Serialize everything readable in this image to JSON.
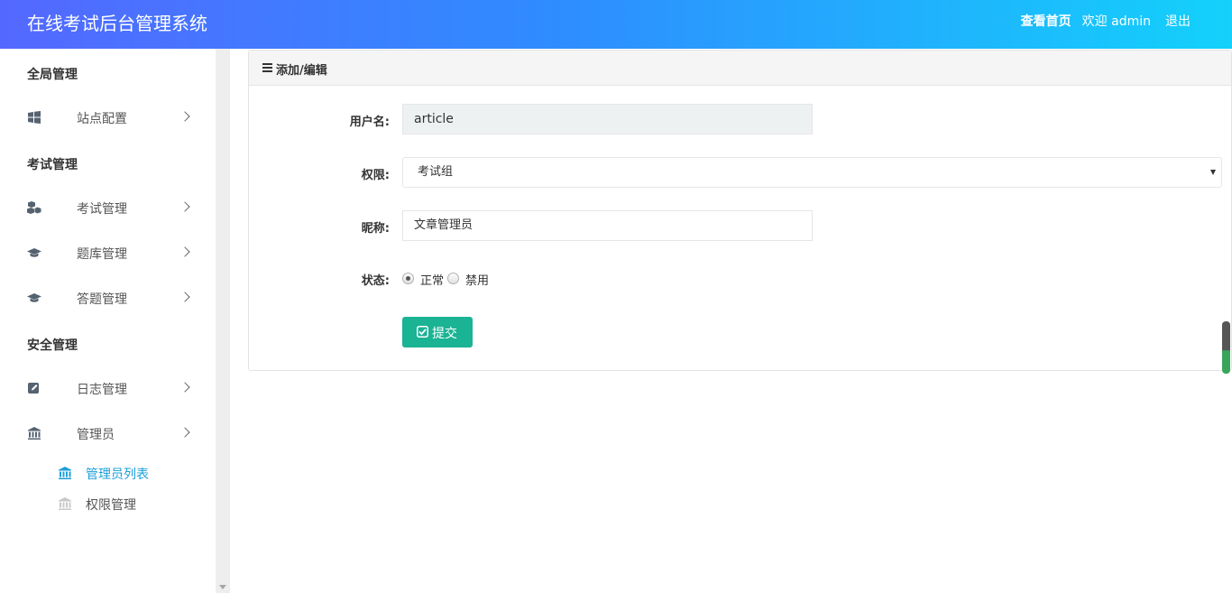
{
  "header": {
    "title": "在线考试后台管理系统",
    "home_link": "查看首页",
    "welcome": "欢迎 admin",
    "logout": "退出"
  },
  "sidebar": {
    "sections": [
      {
        "title": "全局管理"
      },
      {
        "title": "考试管理"
      },
      {
        "title": "安全管理"
      }
    ],
    "items": [
      {
        "label": "站点配置",
        "icon": "windows-icon"
      },
      {
        "label": "考试管理",
        "icon": "cubes-icon"
      },
      {
        "label": "题库管理",
        "icon": "graduation-cap-icon"
      },
      {
        "label": "答题管理",
        "icon": "graduation-cap-icon"
      },
      {
        "label": "日志管理",
        "icon": "edit-icon"
      },
      {
        "label": "管理员",
        "icon": "bank-icon"
      }
    ],
    "subitems": [
      {
        "label": "管理员列表",
        "icon": "bank-icon",
        "active": true
      },
      {
        "label": "权限管理",
        "icon": "bank-icon",
        "active": false
      }
    ]
  },
  "panel": {
    "title": "添加/编辑",
    "fields": {
      "username_label": "用户名:",
      "username_value": "article",
      "role_label": "权限:",
      "role_value": "考试组",
      "nickname_label": "昵称:",
      "nickname_value": "文章管理员",
      "status_label": "状态:",
      "status_options": [
        "正常",
        "禁用"
      ],
      "status_selected": "正常"
    },
    "submit_label": "提交"
  },
  "colors": {
    "header_gradient_start": "#5468ff",
    "header_gradient_end": "#13d1fb",
    "accent": "#1ab394",
    "sidebar_active": "#1c9fd8",
    "icon_gray": "#556270"
  }
}
